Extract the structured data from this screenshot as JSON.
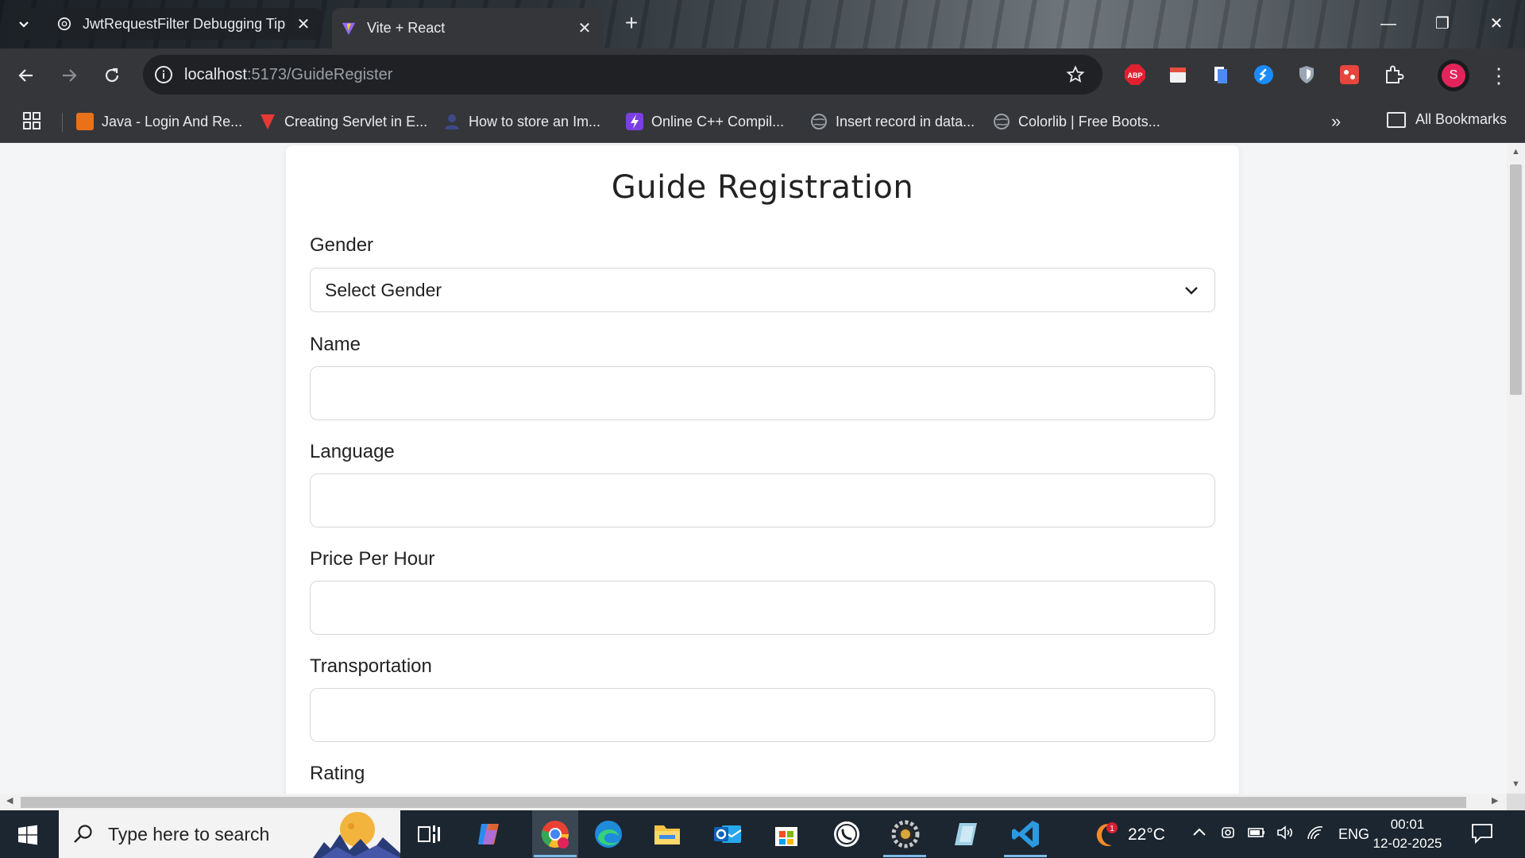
{
  "browser": {
    "tabs": [
      {
        "title": "JwtRequestFilter Debugging Tip",
        "icon": "openai-icon",
        "active": false
      },
      {
        "title": "Vite + React",
        "icon": "vite-icon",
        "active": true
      }
    ],
    "new_tab": "+",
    "address": {
      "host": "localhost",
      "path": ":5173/GuideRegister"
    },
    "profile_initial": "S",
    "extensions": [
      "abp-icon",
      "calendar-icon",
      "docs-icon",
      "shazam-icon",
      "shield-icon",
      "puzzle-extension-icon",
      "extensions-icon"
    ],
    "abp_label": "ABP"
  },
  "bookmarks": {
    "items": [
      {
        "label": "Java - Login And Re...",
        "icon": "javatpoint-icon",
        "color": "#e8711a"
      },
      {
        "label": "Creating Servlet in E...",
        "icon": "red-v-icon",
        "color": "#e53935"
      },
      {
        "label": "How to store an Im...",
        "icon": "user-avatar-icon",
        "color": "#3c4a8a"
      },
      {
        "label": "Online C++ Compil...",
        "icon": "lightning-icon",
        "color": "#7b3fe4"
      },
      {
        "label": "Insert record in data...",
        "icon": "globe-icon",
        "color": "#9aa0a6"
      },
      {
        "label": "Colorlib | Free Boots...",
        "icon": "globe-icon",
        "color": "#9aa0a6"
      }
    ],
    "more": "»",
    "all_bookmarks": "All Bookmarks"
  },
  "form": {
    "title": "Guide Registration",
    "gender_label": "Gender",
    "gender_selected": "Select Gender",
    "fields": [
      {
        "label": "Name",
        "value": ""
      },
      {
        "label": "Language",
        "value": ""
      },
      {
        "label": "Price Per Hour",
        "value": ""
      },
      {
        "label": "Transportation",
        "value": ""
      },
      {
        "label": "Rating",
        "value": ""
      }
    ]
  },
  "taskbar": {
    "search_placeholder": "Type here to search",
    "weather": {
      "temp": "22°C",
      "badge": "1"
    },
    "language": "ENG",
    "time": "00:01",
    "date": "12-02-2025",
    "apps": [
      "task-view-icon",
      "copilot-icon",
      "chrome-icon",
      "edge-icon",
      "file-explorer-icon",
      "outlook-icon",
      "store-icon",
      "whatsapp-icon",
      "settings-gear-app-icon",
      "notes-app-icon",
      "vscode-icon"
    ]
  }
}
